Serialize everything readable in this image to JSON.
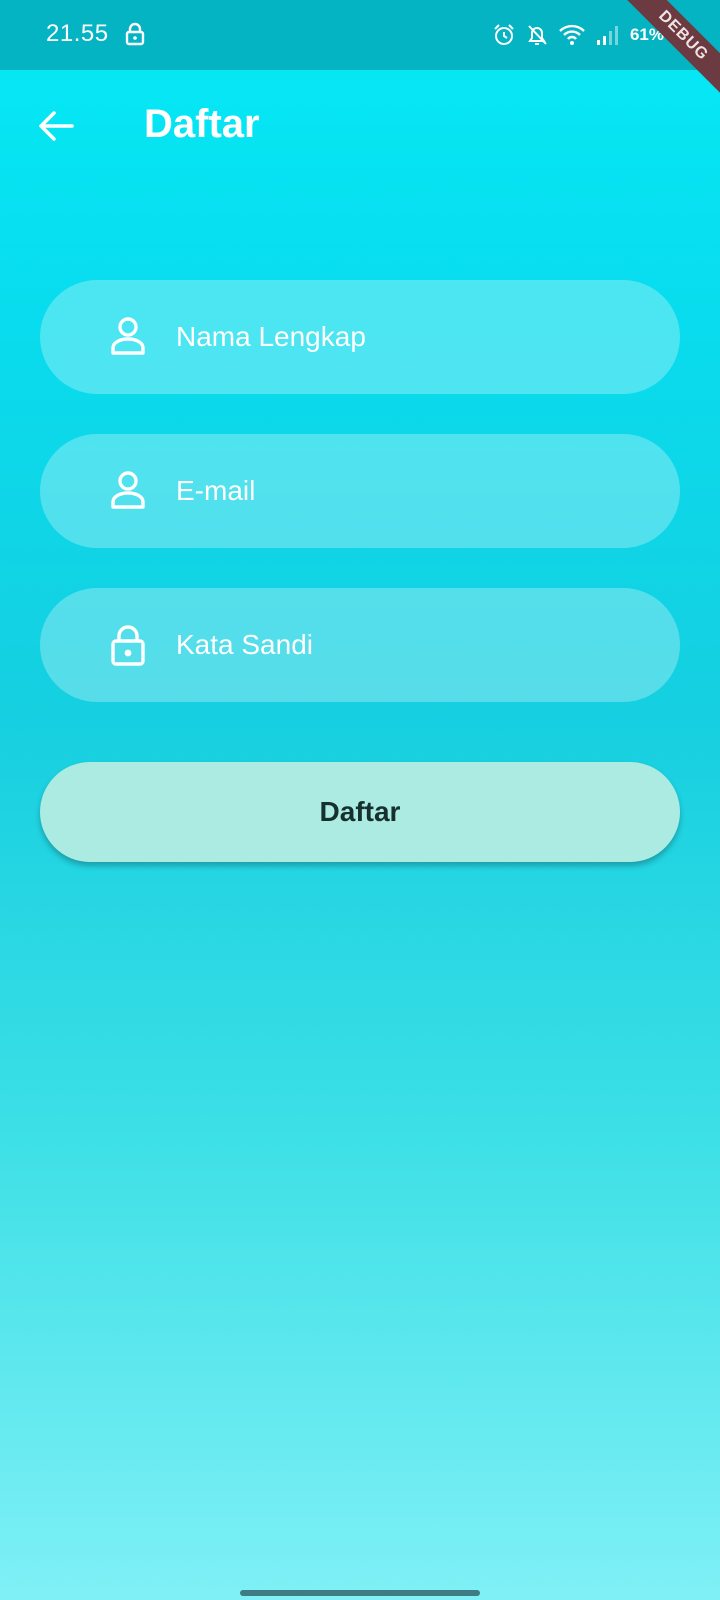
{
  "status_bar": {
    "time": "21.55",
    "battery": "61%"
  },
  "debug_banner": "DEBUG",
  "app_bar": {
    "title": "Daftar"
  },
  "form": {
    "fields": [
      {
        "placeholder": "Nama Lengkap",
        "icon": "person-icon"
      },
      {
        "placeholder": "E-mail",
        "icon": "person-icon"
      },
      {
        "placeholder": "Kata Sandi",
        "icon": "lock-icon"
      }
    ],
    "submit_label": "Daftar"
  },
  "colors": {
    "status_bar": "#04b4c2",
    "button": "#acebe2",
    "debug_ribbon": "#6b3b41"
  }
}
